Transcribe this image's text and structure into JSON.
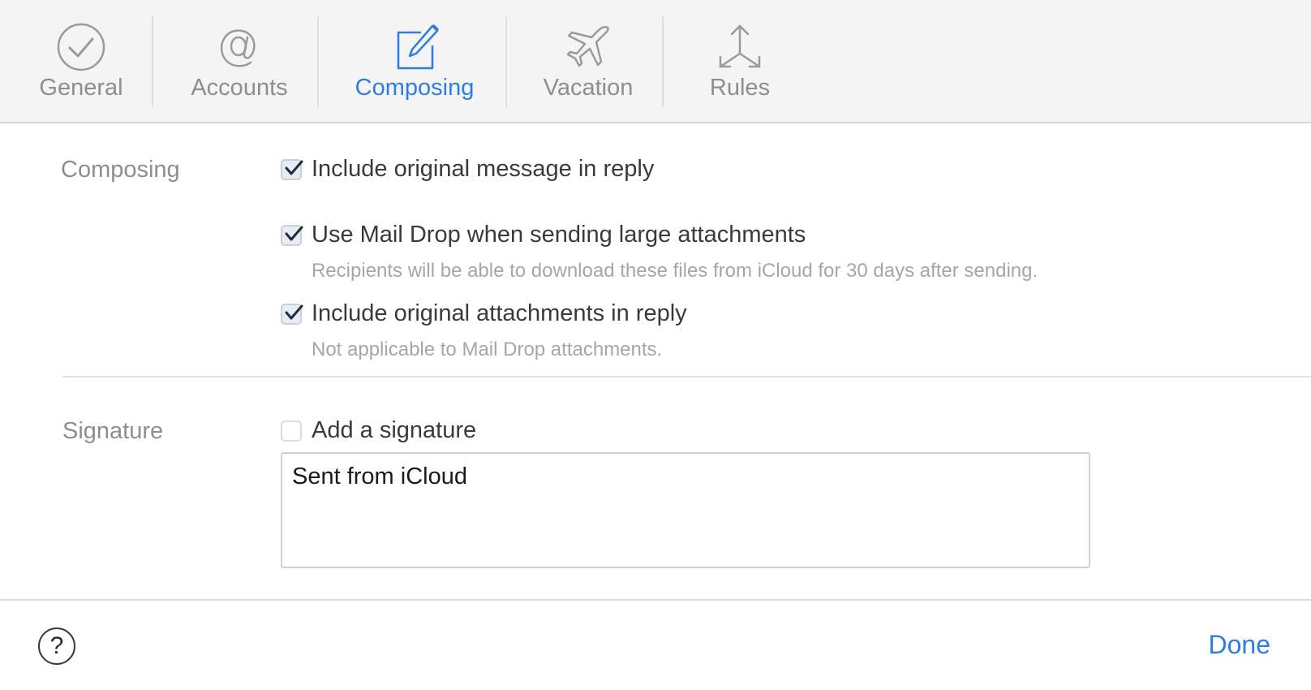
{
  "toolbar": {
    "tabs": [
      {
        "label": "General",
        "icon": "checkmark-circle-icon"
      },
      {
        "label": "Accounts",
        "icon": "at-sign-icon"
      },
      {
        "label": "Composing",
        "icon": "compose-icon",
        "active": true
      },
      {
        "label": "Vacation",
        "icon": "airplane-icon"
      },
      {
        "label": "Rules",
        "icon": "move-arrows-icon"
      }
    ]
  },
  "composing": {
    "section_label": "Composing",
    "options": [
      {
        "label": "Include original message in reply",
        "checked": true,
        "note": ""
      },
      {
        "label": "Use Mail Drop when sending large attachments",
        "checked": true,
        "note": "Recipients will be able to download these files from iCloud for 30 days after sending."
      },
      {
        "label": "Include original attachments in reply",
        "checked": true,
        "note": "Not applicable to Mail Drop attachments."
      }
    ]
  },
  "signature": {
    "section_label": "Signature",
    "option_label": "Add a signature",
    "checked": false,
    "text": "Sent from iCloud"
  },
  "footer": {
    "help_label": "?",
    "done_label": "Done"
  },
  "colors": {
    "accent": "#2f7de1",
    "inactive": "#8e8e8e",
    "toolbar_bg": "#f4f4f4"
  }
}
